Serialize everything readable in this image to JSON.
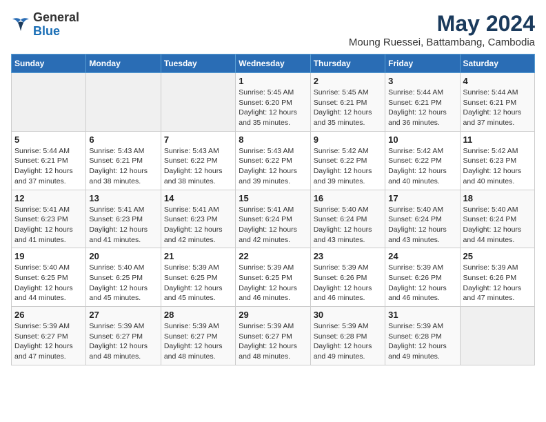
{
  "header": {
    "logo_general": "General",
    "logo_blue": "Blue",
    "title": "May 2024",
    "subtitle": "Moung Ruessei, Battambang, Cambodia"
  },
  "days_of_week": [
    "Sunday",
    "Monday",
    "Tuesday",
    "Wednesday",
    "Thursday",
    "Friday",
    "Saturday"
  ],
  "weeks": [
    [
      {
        "day": "",
        "info": ""
      },
      {
        "day": "",
        "info": ""
      },
      {
        "day": "",
        "info": ""
      },
      {
        "day": "1",
        "sunrise": "5:45 AM",
        "sunset": "6:20 PM",
        "daylight": "12 hours and 35 minutes."
      },
      {
        "day": "2",
        "sunrise": "5:45 AM",
        "sunset": "6:21 PM",
        "daylight": "12 hours and 35 minutes."
      },
      {
        "day": "3",
        "sunrise": "5:44 AM",
        "sunset": "6:21 PM",
        "daylight": "12 hours and 36 minutes."
      },
      {
        "day": "4",
        "sunrise": "5:44 AM",
        "sunset": "6:21 PM",
        "daylight": "12 hours and 37 minutes."
      }
    ],
    [
      {
        "day": "5",
        "sunrise": "5:44 AM",
        "sunset": "6:21 PM",
        "daylight": "12 hours and 37 minutes."
      },
      {
        "day": "6",
        "sunrise": "5:43 AM",
        "sunset": "6:21 PM",
        "daylight": "12 hours and 38 minutes."
      },
      {
        "day": "7",
        "sunrise": "5:43 AM",
        "sunset": "6:22 PM",
        "daylight": "12 hours and 38 minutes."
      },
      {
        "day": "8",
        "sunrise": "5:43 AM",
        "sunset": "6:22 PM",
        "daylight": "12 hours and 39 minutes."
      },
      {
        "day": "9",
        "sunrise": "5:42 AM",
        "sunset": "6:22 PM",
        "daylight": "12 hours and 39 minutes."
      },
      {
        "day": "10",
        "sunrise": "5:42 AM",
        "sunset": "6:22 PM",
        "daylight": "12 hours and 40 minutes."
      },
      {
        "day": "11",
        "sunrise": "5:42 AM",
        "sunset": "6:23 PM",
        "daylight": "12 hours and 40 minutes."
      }
    ],
    [
      {
        "day": "12",
        "sunrise": "5:41 AM",
        "sunset": "6:23 PM",
        "daylight": "12 hours and 41 minutes."
      },
      {
        "day": "13",
        "sunrise": "5:41 AM",
        "sunset": "6:23 PM",
        "daylight": "12 hours and 41 minutes."
      },
      {
        "day": "14",
        "sunrise": "5:41 AM",
        "sunset": "6:23 PM",
        "daylight": "12 hours and 42 minutes."
      },
      {
        "day": "15",
        "sunrise": "5:41 AM",
        "sunset": "6:24 PM",
        "daylight": "12 hours and 42 minutes."
      },
      {
        "day": "16",
        "sunrise": "5:40 AM",
        "sunset": "6:24 PM",
        "daylight": "12 hours and 43 minutes."
      },
      {
        "day": "17",
        "sunrise": "5:40 AM",
        "sunset": "6:24 PM",
        "daylight": "12 hours and 43 minutes."
      },
      {
        "day": "18",
        "sunrise": "5:40 AM",
        "sunset": "6:24 PM",
        "daylight": "12 hours and 44 minutes."
      }
    ],
    [
      {
        "day": "19",
        "sunrise": "5:40 AM",
        "sunset": "6:25 PM",
        "daylight": "12 hours and 44 minutes."
      },
      {
        "day": "20",
        "sunrise": "5:40 AM",
        "sunset": "6:25 PM",
        "daylight": "12 hours and 45 minutes."
      },
      {
        "day": "21",
        "sunrise": "5:39 AM",
        "sunset": "6:25 PM",
        "daylight": "12 hours and 45 minutes."
      },
      {
        "day": "22",
        "sunrise": "5:39 AM",
        "sunset": "6:25 PM",
        "daylight": "12 hours and 46 minutes."
      },
      {
        "day": "23",
        "sunrise": "5:39 AM",
        "sunset": "6:26 PM",
        "daylight": "12 hours and 46 minutes."
      },
      {
        "day": "24",
        "sunrise": "5:39 AM",
        "sunset": "6:26 PM",
        "daylight": "12 hours and 46 minutes."
      },
      {
        "day": "25",
        "sunrise": "5:39 AM",
        "sunset": "6:26 PM",
        "daylight": "12 hours and 47 minutes."
      }
    ],
    [
      {
        "day": "26",
        "sunrise": "5:39 AM",
        "sunset": "6:27 PM",
        "daylight": "12 hours and 47 minutes."
      },
      {
        "day": "27",
        "sunrise": "5:39 AM",
        "sunset": "6:27 PM",
        "daylight": "12 hours and 48 minutes."
      },
      {
        "day": "28",
        "sunrise": "5:39 AM",
        "sunset": "6:27 PM",
        "daylight": "12 hours and 48 minutes."
      },
      {
        "day": "29",
        "sunrise": "5:39 AM",
        "sunset": "6:27 PM",
        "daylight": "12 hours and 48 minutes."
      },
      {
        "day": "30",
        "sunrise": "5:39 AM",
        "sunset": "6:28 PM",
        "daylight": "12 hours and 49 minutes."
      },
      {
        "day": "31",
        "sunrise": "5:39 AM",
        "sunset": "6:28 PM",
        "daylight": "12 hours and 49 minutes."
      },
      {
        "day": "",
        "info": ""
      }
    ]
  ],
  "labels": {
    "sunrise": "Sunrise: ",
    "sunset": "Sunset: ",
    "daylight": "Daylight: "
  }
}
